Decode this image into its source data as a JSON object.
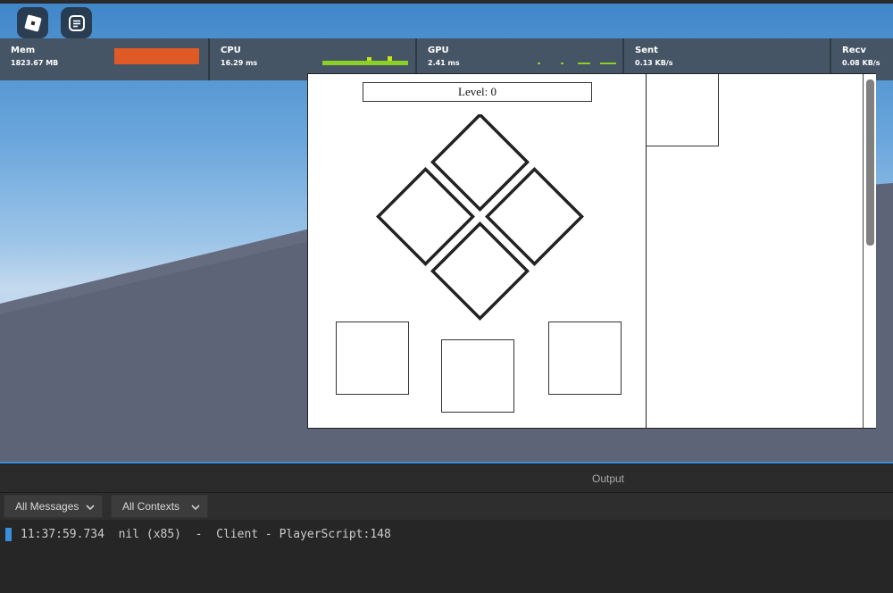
{
  "viewport": {
    "menu_button_icon": "roblox-logo-icon",
    "chat_button_icon": "chat-icon",
    "colors": {
      "sky": "#6aa6dc",
      "baseplate": "#5d6477"
    }
  },
  "stats": [
    {
      "name": "Mem",
      "value": "1823.67 MB",
      "graph_color": "#e05a25"
    },
    {
      "name": "CPU",
      "value": "16.29 ms",
      "graph_color": "#8bd024"
    },
    {
      "name": "GPU",
      "value": "2.41 ms",
      "graph_color": "#8bd024"
    },
    {
      "name": "Sent",
      "value": "0.13 KB/s"
    },
    {
      "name": "Recv",
      "value": "0.08 KB/s"
    }
  ],
  "game": {
    "level_label": "Level: 0",
    "diamond_tiles": [
      "top",
      "left",
      "right",
      "bottom"
    ],
    "choice_boxes": [
      "left",
      "center",
      "right"
    ]
  },
  "output": {
    "title": "Output",
    "message_filter": "All Messages",
    "context_filter": "All Contexts",
    "log_line": "11:37:59.734  nil (x85)  -  Client - PlayerScript:148"
  }
}
